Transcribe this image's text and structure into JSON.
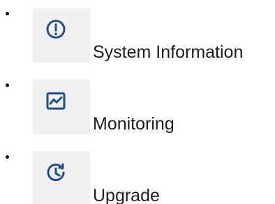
{
  "menu": {
    "items": [
      {
        "label": "System Information",
        "icon": "info-circle-icon"
      },
      {
        "label": "Monitoring",
        "icon": "monitoring-chart-icon"
      },
      {
        "label": "Upgrade",
        "icon": "upgrade-clock-icon"
      }
    ]
  },
  "colors": {
    "icon_tile_bg": "#eef0f2",
    "icon_blue": "#1f4f86",
    "text": "#1d1d1f",
    "bullet": "#000000"
  }
}
